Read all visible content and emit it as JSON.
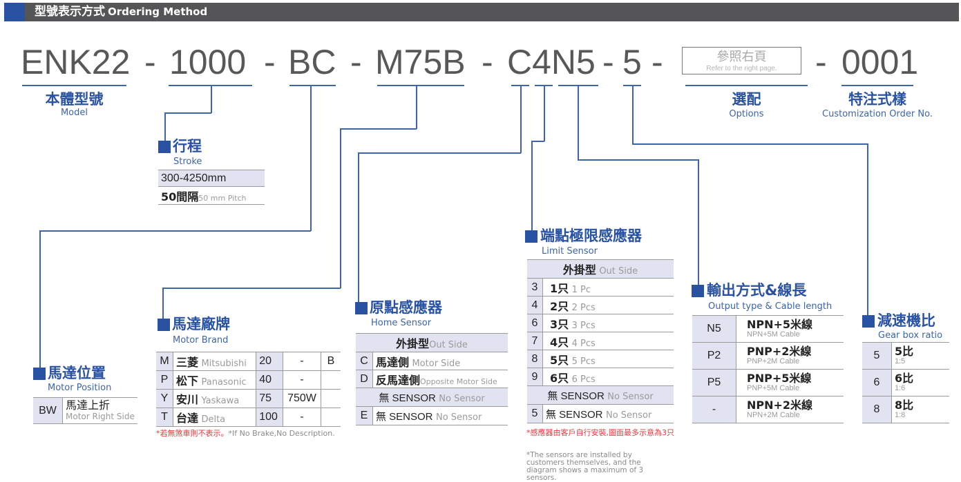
{
  "header": {
    "title_zh": "型號表示方式",
    "title_en": "Ordering Method",
    "accent_color": "#2952a3",
    "bar_color": "#555557"
  },
  "code": {
    "model": "ENK22",
    "sep1": "-",
    "stroke": "1000",
    "sep2": "-",
    "position": "BC",
    "sep3": "-",
    "brand": "M75B",
    "sep4": "-",
    "sensor": "C4N5",
    "sep5": "-",
    "ratio": "5",
    "sep6": "-",
    "sep7": "-",
    "custom": "0001"
  },
  "options_box": {
    "zh": "參照右頁",
    "en": "Refer to the right page."
  },
  "segments": {
    "model": {
      "zh": "本體型號",
      "en": "Model"
    },
    "options": {
      "zh": "選配",
      "en": "Options"
    },
    "custom": {
      "zh": "特注式樣",
      "en": "Customization Order No."
    }
  },
  "stroke": {
    "title_zh": "行程",
    "title_en": "Stroke",
    "range": "300-4250mm",
    "pitch_zh": "50間隔",
    "pitch_en": "50 mm Pitch"
  },
  "motor_position": {
    "title_zh": "馬達位置",
    "title_en": "Motor Position",
    "rows": [
      {
        "code": "BW",
        "zh": "馬達上折",
        "en": "Motor Right Side"
      }
    ]
  },
  "motor_brand": {
    "title_zh": "馬達廠牌",
    "title_en": "Motor Brand",
    "rows": [
      {
        "code": "M",
        "zh": "三菱",
        "en": "Mitsubishi",
        "power": "20",
        "watt": "-",
        "brake": "B"
      },
      {
        "code": "P",
        "zh": "松下",
        "en": "Panasonic",
        "power": "40",
        "watt": "-",
        "brake": ""
      },
      {
        "code": "Y",
        "zh": "安川",
        "en": "Yaskawa",
        "power": "75",
        "watt": "750W",
        "brake": ""
      },
      {
        "code": "T",
        "zh": "台達",
        "en": "Delta",
        "power": "100",
        "watt": "-",
        "brake": ""
      }
    ],
    "note_zh": "*若無煞車則不表示。",
    "note_en": "*If No Brake,No Description."
  },
  "home_sensor": {
    "title_zh": "原點感應器",
    "title_en": "Home Sensor",
    "header_zh": "外掛型",
    "header_en": "Out Side",
    "rows": [
      {
        "code": "C",
        "zh": "馬達側",
        "en": "Motor Side"
      },
      {
        "code": "D",
        "zh": "反馬達側",
        "en": "Opposite Motor Side"
      }
    ],
    "none_header_zh": "無 SENSOR",
    "none_header_en": "No Sensor",
    "none_row": {
      "code": "E",
      "zh": "無 SENSOR",
      "en": "No Sensor"
    }
  },
  "limit_sensor": {
    "title_zh": "端點極限感應器",
    "title_en": "Limit Sensor",
    "header_zh": "外掛型",
    "header_en": "Out Side",
    "rows": [
      {
        "code": "3",
        "zh": "1只",
        "en": "1 Pc"
      },
      {
        "code": "4",
        "zh": "2只",
        "en": "2 Pcs"
      },
      {
        "code": "6",
        "zh": "3只",
        "en": "3 Pcs"
      },
      {
        "code": "7",
        "zh": "4只",
        "en": "4 Pcs"
      },
      {
        "code": "8",
        "zh": "5只",
        "en": "5 Pcs"
      },
      {
        "code": "9",
        "zh": "6只",
        "en": "6 Pcs"
      }
    ],
    "none_header_zh": "無 SENSOR",
    "none_header_en": "No Sensor",
    "none_row": {
      "code": "5",
      "zh": "無 SENSOR",
      "en": "No Sensor"
    },
    "note_zh": "*感應器由客戶自行安裝,圖面最多示意為3只",
    "note_en": "*The sensors are installed by customers themselves, and the diagram shows a maximum of 3 sensors."
  },
  "output_type": {
    "title_zh": "輸出方式&線長",
    "title_en": "Output type & Cable length",
    "rows": [
      {
        "code": "N5",
        "zh": "NPN+5米線",
        "en": "NPN+5M Cable"
      },
      {
        "code": "P2",
        "zh": "PNP+2米線",
        "en": "PNP+2M Cable"
      },
      {
        "code": "P5",
        "zh": "PNP+5米線",
        "en": "PNP+5M Cable"
      },
      {
        "code": "-",
        "zh": "NPN+2米線",
        "en": "NPN+2M Cable"
      }
    ]
  },
  "gear_ratio": {
    "title_zh": "減速機比",
    "title_en": "Gear box ratio",
    "rows": [
      {
        "code": "5",
        "zh": "5比",
        "en": "1:5"
      },
      {
        "code": "6",
        "zh": "6比",
        "en": "1:6"
      },
      {
        "code": "8",
        "zh": "8比",
        "en": "1:8"
      }
    ]
  }
}
